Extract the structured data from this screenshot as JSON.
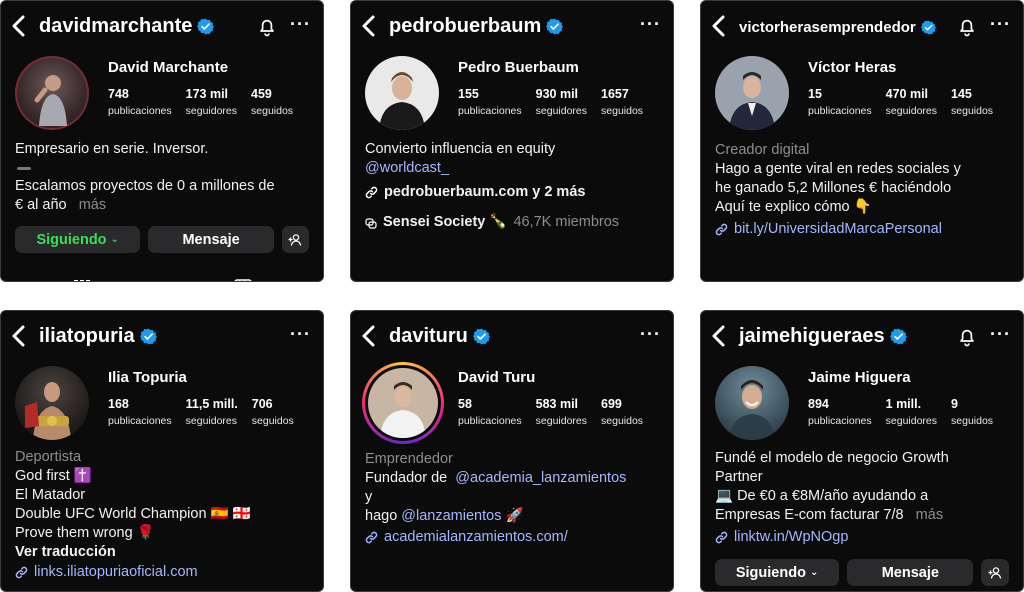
{
  "cards": [
    {
      "username": "davidmarchante",
      "fullname": "David Marchante",
      "stats": [
        {
          "n": "748",
          "l": "publicaciones"
        },
        {
          "n": "173 mil",
          "l": "seguidores"
        },
        {
          "n": "459",
          "l": "seguidos"
        }
      ],
      "bio1": "Empresario en serie. Inversor.",
      "bio2": "Escalamos proyectos de 0 a millones de",
      "bio3": "€ al año",
      "more": "más",
      "follow_label": "Siguiendo",
      "message_label": "Mensaje"
    },
    {
      "username": "pedrobuerbaum",
      "fullname": "Pedro Buerbaum",
      "stats": [
        {
          "n": "155",
          "l": "publicaciones"
        },
        {
          "n": "930 mil",
          "l": "seguidores"
        },
        {
          "n": "1657",
          "l": "seguidos"
        }
      ],
      "bio1": "Convierto influencia en equity",
      "mention": "@worldcast_",
      "link": "pedrobuerbaum.com y 2 más",
      "community": "Sensei Society 🍾",
      "members": "46,7K miembros"
    },
    {
      "username": "victorherasemprendedor",
      "fullname": "Víctor Heras",
      "stats": [
        {
          "n": "15",
          "l": "publicaciones"
        },
        {
          "n": "470 mil",
          "l": "seguidores"
        },
        {
          "n": "145",
          "l": "seguidos"
        }
      ],
      "category": "Creador digital",
      "bio1": "Hago a gente viral en redes sociales y",
      "bio2": "he ganado 5,2 Millones € haciéndolo",
      "bio3": "Aquí te explico cómo 👇",
      "link": "bit.ly/UniversidadMarcaPersonal"
    },
    {
      "username": "iliatopuria",
      "fullname": "Ilia Topuria",
      "stats": [
        {
          "n": "168",
          "l": "publicaciones"
        },
        {
          "n": "11,5 mill.",
          "l": "seguidores"
        },
        {
          "n": "706",
          "l": "seguidos"
        }
      ],
      "category": "Deportista",
      "bio1": "God first ✝️",
      "bio2": "El Matador",
      "bio3": "Double UFC World Champion 🇪🇸 🇬🇪",
      "bio4": "Prove them wrong 🌹",
      "translate": "Ver traducción",
      "link": "links.iliatopuriaoficial.com"
    },
    {
      "username": "davituru",
      "fullname": "David Turu",
      "stats": [
        {
          "n": "58",
          "l": "publicaciones"
        },
        {
          "n": "583 mil",
          "l": "seguidores"
        },
        {
          "n": "699",
          "l": "seguidos"
        }
      ],
      "category": "Emprendedor",
      "bio1": "Fundador de",
      "mention1": "@academia_lanzamientos",
      "bio2": "y",
      "bio3": "hago",
      "mention2": "@lanzamientos",
      "emoji": "🚀",
      "link": "academialanzamientos.com/"
    },
    {
      "username": "jaimehigueraes",
      "fullname": "Jaime Higuera",
      "stats": [
        {
          "n": "894",
          "l": "publicaciones"
        },
        {
          "n": "1 mill.",
          "l": "seguidores"
        },
        {
          "n": "9",
          "l": "seguidos"
        }
      ],
      "bio1": "Fundé el modelo de negocio Growth",
      "bio2": "Partner",
      "bio3": "💻 De €0 a €8M/año ayudando a",
      "bio4": "Empresas E-com facturar 7/8",
      "more": "más",
      "link": "linktw.in/WpNOgp",
      "follow_label": "Siguiendo",
      "message_label": "Mensaje"
    }
  ]
}
